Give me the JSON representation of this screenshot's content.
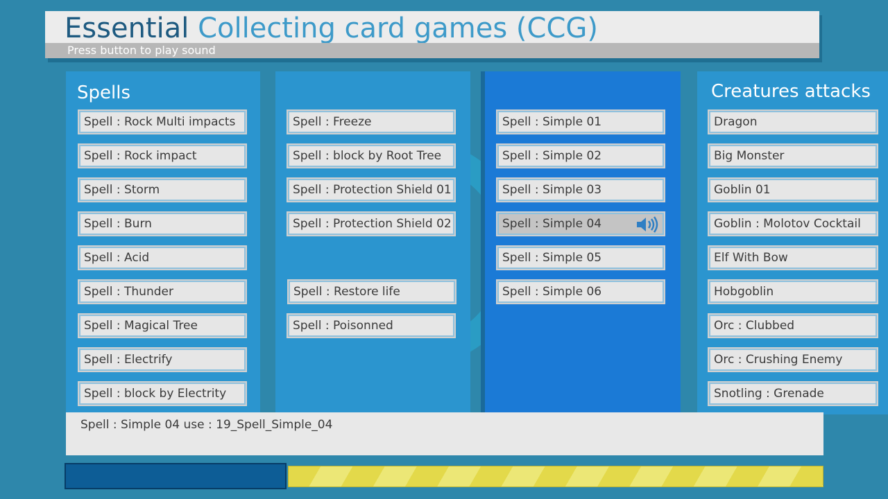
{
  "header": {
    "title_part1": "Essential",
    "title_part2": "Collecting card games (CCG)",
    "subtitle": "Press button to play sound"
  },
  "columns": [
    {
      "title": "Spells",
      "items": [
        "Spell : Rock Multi impacts",
        "Spell : Rock impact",
        "Spell : Storm",
        "Spell : Burn",
        "Spell : Acid",
        "Spell : Thunder",
        "Spell : Magical Tree",
        "Spell : Electrify",
        "Spell : block by Electrity"
      ]
    },
    {
      "title": "",
      "items": [
        "Spell : Freeze",
        "Spell : block by Root Tree",
        "Spell : Protection Shield 01",
        "Spell : Protection Shield 02",
        "Spell : Restore life",
        "Spell : Poisonned"
      ]
    },
    {
      "title": "",
      "items": [
        "Spell : Simple 01",
        "Spell : Simple 02",
        "Spell : Simple 03",
        "Spell : Simple 04",
        "Spell : Simple 05",
        "Spell : Simple 06"
      ],
      "active_item": "Spell : Simple 04",
      "active_icon": "speaker-icon"
    },
    {
      "title": "Creatures attacks",
      "items": [
        "Dragon",
        "Big Monster",
        "Goblin 01",
        "Goblin : Molotov Cocktail",
        "Elf With Bow",
        "Hobgoblin",
        "Orc : Clubbed",
        "Orc : Crushing Enemy",
        "Snotling : Grenade"
      ]
    }
  ],
  "info": {
    "text": "Spell : Simple 04 use : 19_Spell_Simple_04"
  },
  "colors": {
    "background": "#2e87ab",
    "panel": "#2b95cf",
    "panel_active": "#1b7ad6",
    "title_dark": "#1e5a80",
    "title_light": "#3d9ac9",
    "progress_stripe": "#e3d94a",
    "progress_left": "#0d5d96"
  }
}
